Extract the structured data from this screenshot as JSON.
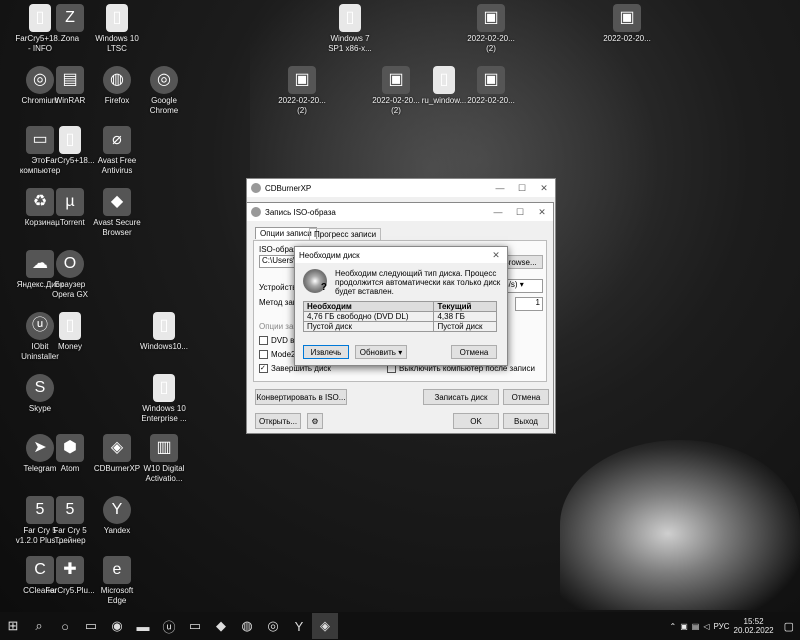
{
  "desktop_icons": [
    {
      "label": "FarCry5+18...\n- INFO",
      "icon": "document-icon"
    },
    {
      "label": "Zona",
      "icon": "zona-icon"
    },
    {
      "label": "Windows 10\nLTSC",
      "icon": "document-icon"
    },
    {
      "label": "Windows 7\nSP1 x86-x...",
      "icon": "document-icon"
    },
    {
      "label": "2022-02-20...\n(2)",
      "icon": "image-icon"
    },
    {
      "label": "2022-02-20...",
      "icon": "image-icon"
    },
    {
      "label": "Chromium",
      "icon": "chromium-icon"
    },
    {
      "label": "WinRAR",
      "icon": "winrar-icon"
    },
    {
      "label": "Firefox",
      "icon": "firefox-icon"
    },
    {
      "label": "Google\nChrome",
      "icon": "chrome-icon"
    },
    {
      "label": "2022-02-20...\n(2)",
      "icon": "image-icon"
    },
    {
      "label": "2022-02-20...\n(2)",
      "icon": "image-icon"
    },
    {
      "label": "ru_window...",
      "icon": "document-icon"
    },
    {
      "label": "2022-02-20...",
      "icon": "image-icon"
    },
    {
      "label": "Этот\nкомпьютер",
      "icon": "computer-icon"
    },
    {
      "label": "FarCry5+18...",
      "icon": "document-icon"
    },
    {
      "label": "Avast Free\nAntivirus",
      "icon": "avast-icon"
    },
    {
      "label": "Корзина",
      "icon": "recycle-bin-icon"
    },
    {
      "label": "µTorrent",
      "icon": "utorrent-icon"
    },
    {
      "label": "Avast Secure\nBrowser",
      "icon": "avast-browser-icon"
    },
    {
      "label": "Яндекс.Диск",
      "icon": "yandex-disk-icon"
    },
    {
      "label": "Браузер\nOpera GX",
      "icon": "opera-gx-icon"
    },
    {
      "label": "IObit\nUninstaller",
      "icon": "iobit-icon"
    },
    {
      "label": "Money",
      "icon": "document-icon"
    },
    {
      "label": "Windows10...",
      "icon": "document-icon"
    },
    {
      "label": "Skype",
      "icon": "skype-icon"
    },
    {
      "label": "Windows 10\nEnterprise ...",
      "icon": "document-icon"
    },
    {
      "label": "Telegram",
      "icon": "telegram-icon"
    },
    {
      "label": "Atom",
      "icon": "atom-icon"
    },
    {
      "label": "CDBurnerXP",
      "icon": "cdburnerxp-icon"
    },
    {
      "label": "W10 Digital\nActivatio...",
      "icon": "archive-icon"
    },
    {
      "label": "Far Cry 5\nv1.2.0 Plus ...",
      "icon": "farcry-icon"
    },
    {
      "label": "Far Cry 5\nТрейнер",
      "icon": "farcry-trainer-icon"
    },
    {
      "label": "Yandex",
      "icon": "yandex-icon"
    },
    {
      "label": "CCleaner",
      "icon": "ccleaner-icon"
    },
    {
      "label": "FarCry5.Plu...",
      "icon": "farcry-plus-icon"
    },
    {
      "label": "Microsoft\nEdge",
      "icon": "edge-icon"
    }
  ],
  "cdburner": {
    "title": "CDBurnerXP"
  },
  "iso_window": {
    "title": "Запись ISO-образа",
    "tabs": [
      "Опции записи",
      "Прогресс записи"
    ],
    "iso_label": "ISO-образ д...",
    "iso_path": "C:\\Users\\a...",
    "browse_label": "Browse...",
    "device_label": "Устройство",
    "speed_value": "KB/s)",
    "method_label": "Метод запи...",
    "copies_value": "1",
    "options_label": "Опции запи...",
    "opt_dvd": "DVD вы...",
    "opt_mode2": "Mode2/...",
    "opt_finalize": "Завершить диск",
    "opt_shutdown": "Выключить компьютер после записи",
    "convert_label": "Конвертировать в ISO...",
    "burn_label": "Записать диск",
    "cancel_label": "Отмена",
    "open_label": "Открыть...",
    "ok_label": "OK",
    "exit_label": "Выход"
  },
  "dialog": {
    "title": "Необходим диск",
    "message": "Необходим следующий тип диска. Процесс продолжится автоматически как только диск будет вставлен.",
    "col_required": "Необходим",
    "col_current": "Текущий",
    "req_1": "4,76 ГБ свободно (DVD DL)",
    "cur_1": "4,38 ГБ",
    "req_2": "Пустой диск",
    "cur_2": "Пустой диск",
    "eject_label": "Извлечь",
    "refresh_label": "Обновить",
    "cancel_label": "Отмена"
  },
  "taskbar": {
    "lang": "РУС",
    "time": "15:52",
    "date": "20.02.2022"
  }
}
